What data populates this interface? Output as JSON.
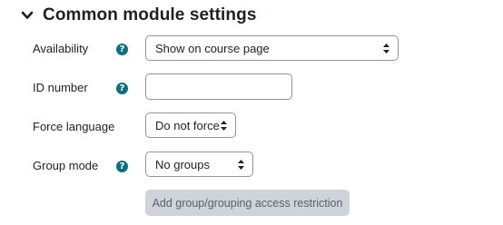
{
  "section": {
    "title": "Common module settings",
    "toggle_icon": "chevron-down-icon",
    "expanded": true
  },
  "fields": {
    "availability": {
      "label": "Availability",
      "value": "Show on course page",
      "has_help": true
    },
    "id_number": {
      "label": "ID number",
      "value": "",
      "has_help": true
    },
    "force_language": {
      "label": "Force language",
      "value": "Do not force",
      "has_help": false
    },
    "group_mode": {
      "label": "Group mode",
      "value": "No groups",
      "has_help": true
    }
  },
  "help_icon": {
    "name": "help-icon",
    "glyph": "?",
    "color": "#0f6f80"
  },
  "add_restriction_button": {
    "label": "Add group/grouping access restriction",
    "disabled": true
  }
}
